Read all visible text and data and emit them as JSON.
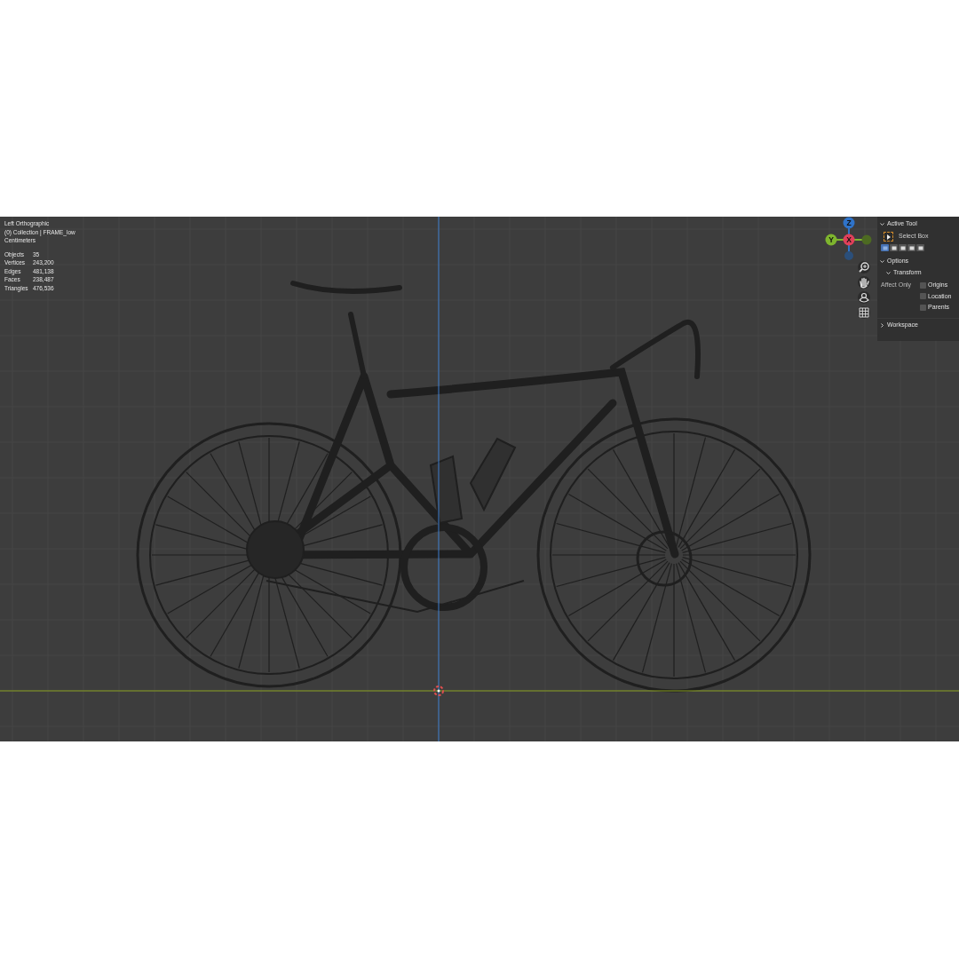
{
  "viewport": {
    "view_name": "Left Orthographic",
    "collection": "(0) Collection | FRAME_low",
    "units": "Centimeters",
    "stats": [
      {
        "label": "Objects",
        "value": "35"
      },
      {
        "label": "Vertices",
        "value": "243,200"
      },
      {
        "label": "Edges",
        "value": "481,138"
      },
      {
        "label": "Faces",
        "value": "238,487"
      },
      {
        "label": "Triangles",
        "value": "476,536"
      }
    ]
  },
  "gizmo": {
    "axes": [
      {
        "label": "Z",
        "kind": "up",
        "color": "#2f73c9"
      },
      {
        "label": "Y",
        "kind": "left",
        "color": "#7eb52e"
      },
      {
        "label": "X",
        "kind": "center",
        "color": "#e0405a"
      }
    ]
  },
  "nav_tools": [
    {
      "kind": "zoom"
    },
    {
      "kind": "pan"
    },
    {
      "kind": "camera"
    },
    {
      "kind": "grid"
    }
  ],
  "sidebar": {
    "active_tool": {
      "title": "Active Tool",
      "expanded": true,
      "tool_name": "Select Box",
      "modes": [
        {
          "selected": true
        },
        {
          "selected": false
        },
        {
          "selected": false
        },
        {
          "selected": false
        },
        {
          "selected": false
        }
      ]
    },
    "options": {
      "title": "Options",
      "expanded": true,
      "transform": {
        "title": "Transform",
        "expanded": true,
        "affect_label": "Affect Only",
        "checkboxes": [
          {
            "label": "Origins",
            "checked": false
          },
          {
            "label": "Location",
            "checked": false
          },
          {
            "label": "Parents",
            "checked": false
          }
        ]
      }
    },
    "workspace": {
      "title": "Workspace",
      "expanded": false
    }
  }
}
